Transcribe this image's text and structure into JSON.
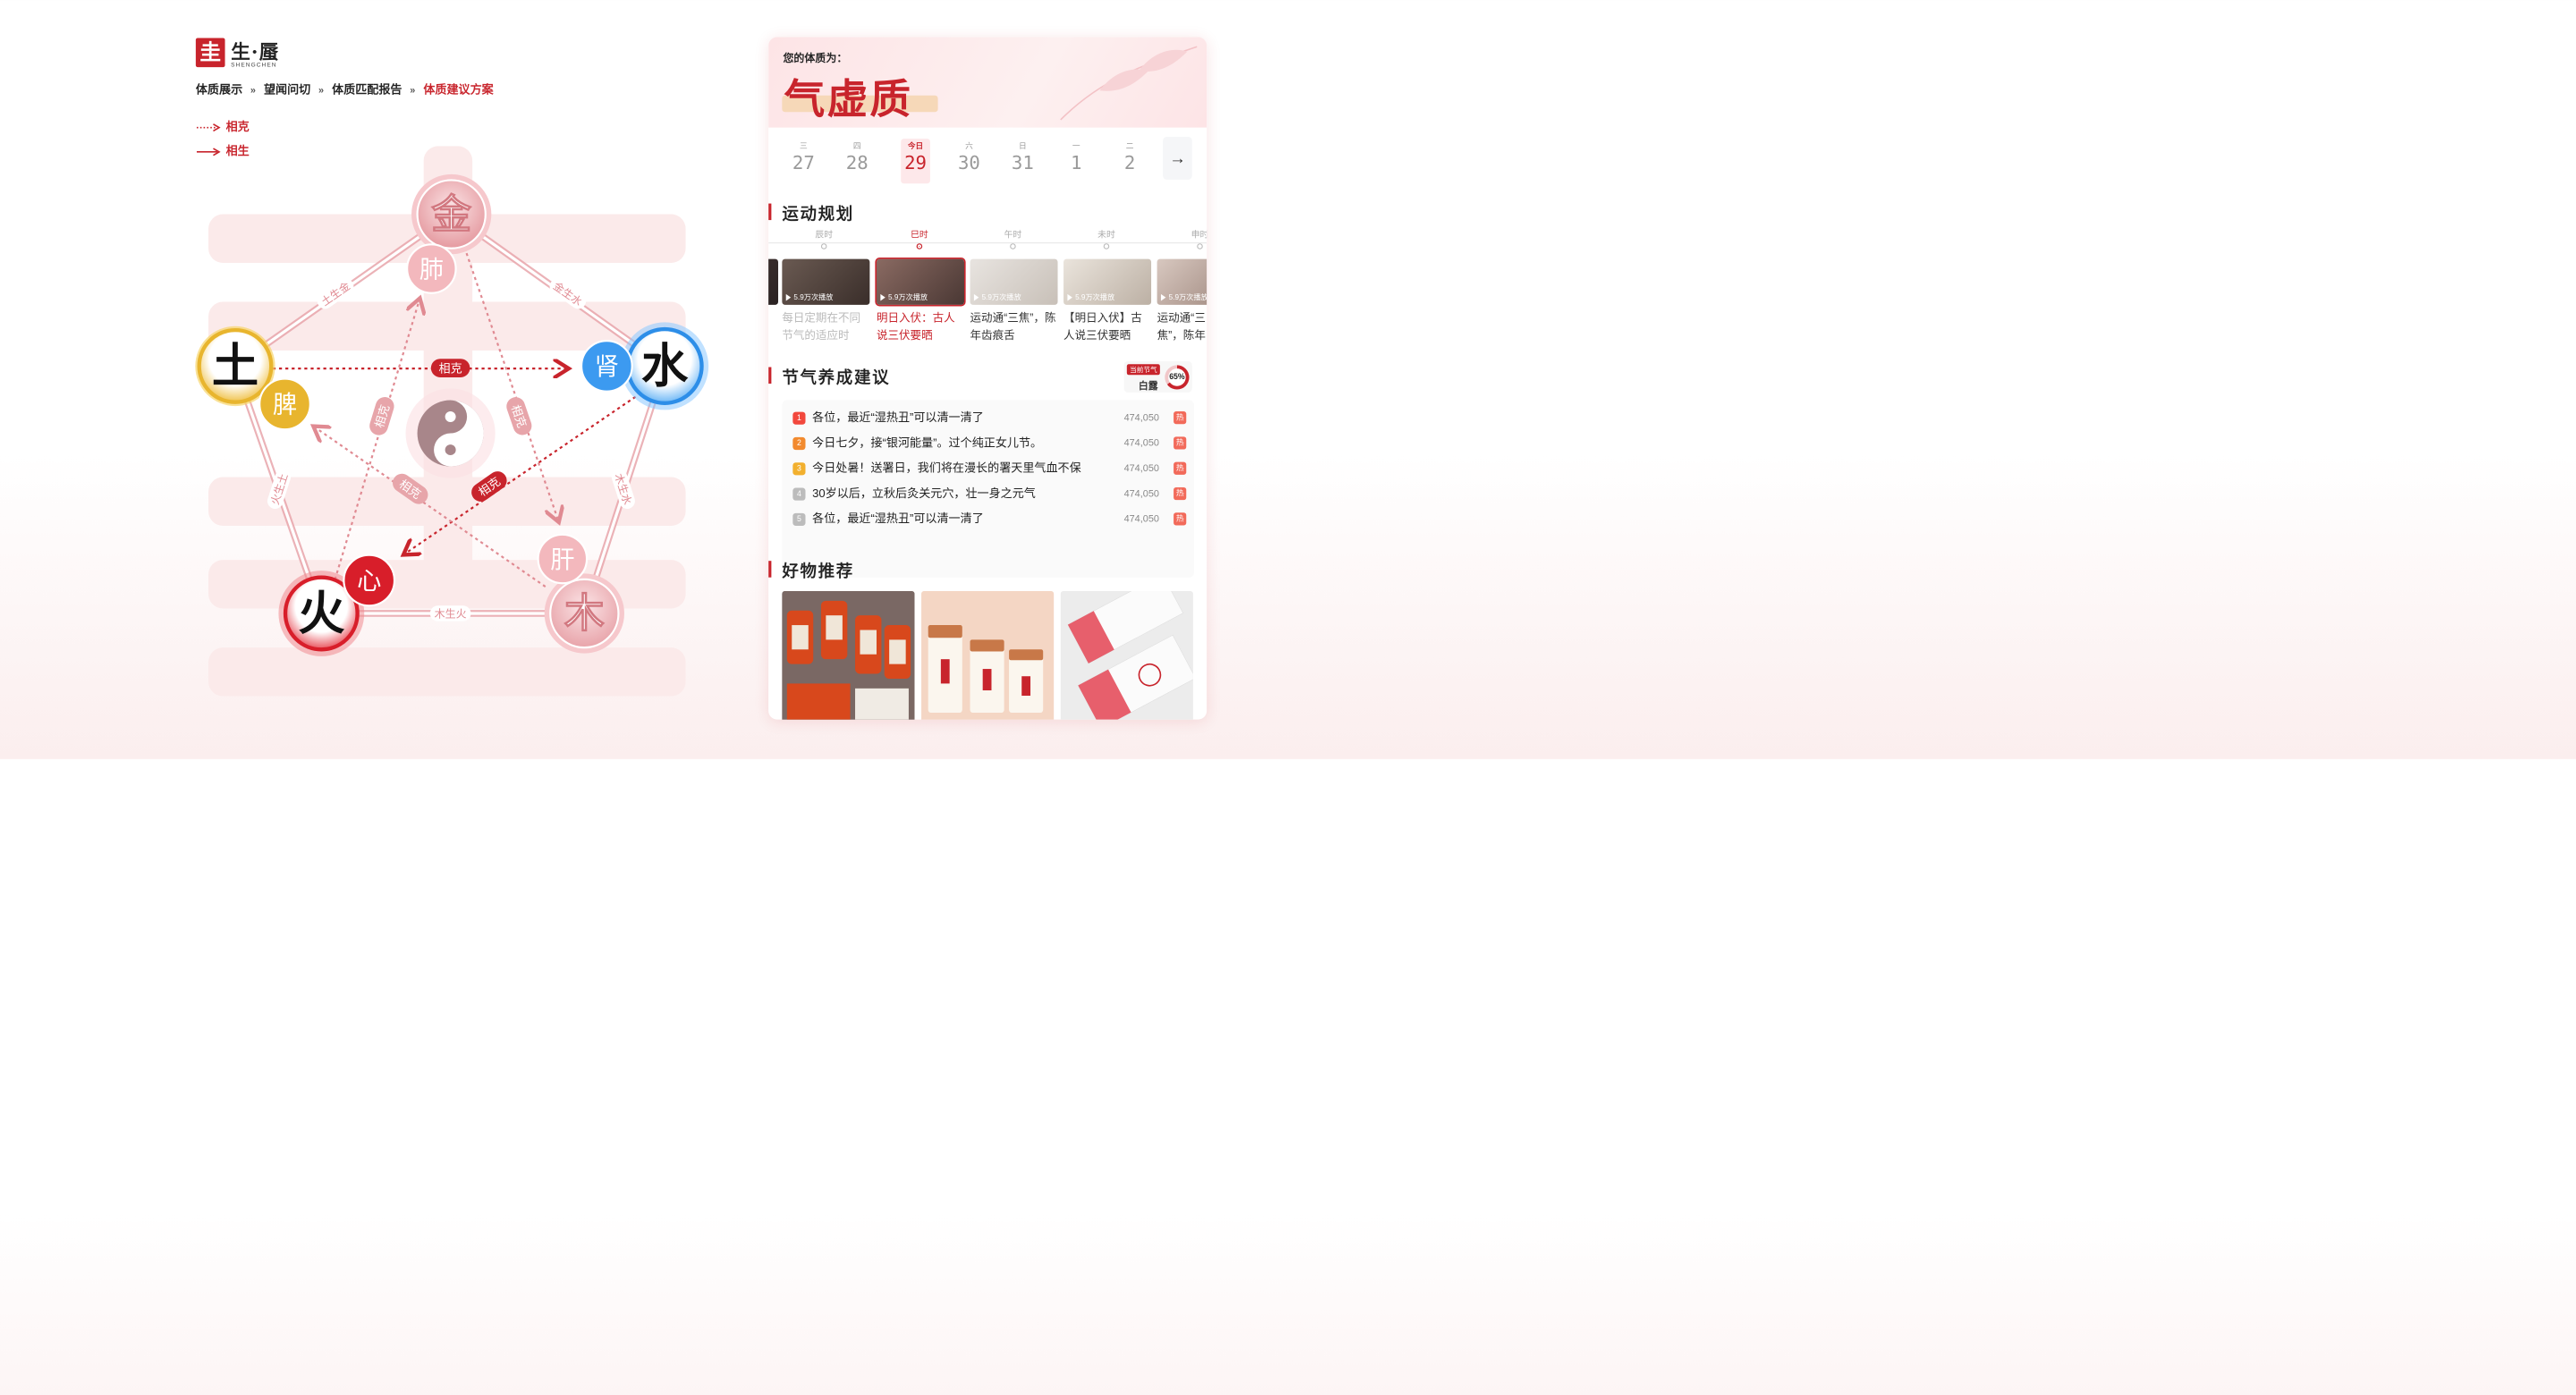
{
  "brand": {
    "logo_char": "圭",
    "title": "生·蜃",
    "subtitle": "SHENGCHEN"
  },
  "breadcrumb": [
    "体质展示",
    "望闻问切",
    "体质匹配报告",
    "体质建议方案"
  ],
  "breadcrumb_sep": "»",
  "legend": {
    "restrain": "相克",
    "generate": "相生"
  },
  "diagram": {
    "elements": {
      "metal": "金",
      "water": "水",
      "wood": "木",
      "fire": "火",
      "earth": "土"
    },
    "organs": {
      "lung": "肺",
      "kidney": "肾",
      "liver": "肝",
      "heart": "心",
      "spleen": "脾"
    },
    "generate_labels": {
      "earth_metal": "土生金",
      "metal_water": "金生水",
      "water_wood": "木生水",
      "wood_fire": "木生火",
      "fire_earth": "火生土"
    },
    "restrain_label": "相克"
  },
  "constitution": {
    "label": "您的体质为：",
    "name": "气虚质"
  },
  "calendar": {
    "days": [
      {
        "wk": "三",
        "d": "27"
      },
      {
        "wk": "四",
        "d": "28"
      },
      {
        "wk": "今日",
        "d": "29"
      },
      {
        "wk": "六",
        "d": "30"
      },
      {
        "wk": "日",
        "d": "31"
      },
      {
        "wk": "一",
        "d": "1"
      },
      {
        "wk": "二",
        "d": "2"
      }
    ],
    "more": "→"
  },
  "exercise": {
    "title": "运动规划",
    "times": [
      "辰时",
      "巳时",
      "午时",
      "未时",
      "申时"
    ],
    "videos": [
      {
        "plays": "5.9万次播放",
        "title": "每日定期在不同节气的适应时"
      },
      {
        "plays": "5.9万次播放",
        "title": "明日入伏：古人说三伏要晒"
      },
      {
        "plays": "5.9万次播放",
        "title": "运动通“三焦”，陈年齿痕舌"
      },
      {
        "plays": "5.9万次播放",
        "title": "【明日入伏】古人说三伏要晒"
      },
      {
        "plays": "5.9万次播放",
        "title": "运动通“三焦”，陈年齿痕舌"
      }
    ]
  },
  "solar_term": {
    "title": "节气养成建议",
    "current_tag": "当前节气",
    "current_term": "白露",
    "progress_label": "65%",
    "progress": 0.65,
    "items": [
      {
        "n": "1",
        "text": "各位，最近“湿热丑”可以清一清了",
        "count": "474,050",
        "hot": "热"
      },
      {
        "n": "2",
        "text": "今日七夕，接“银河能量”。过个纯正女儿节。",
        "count": "474,050",
        "hot": "热"
      },
      {
        "n": "3",
        "text": "今日处暑！送署日，我们将在漫长的署天里气血不保",
        "count": "474,050",
        "hot": "热"
      },
      {
        "n": "4",
        "text": "30岁以后，立秋后灸关元穴，壮一身之元气",
        "count": "474,050",
        "hot": "热"
      },
      {
        "n": "5",
        "text": "各位，最近“湿热丑”可以清一清了",
        "count": "474,050",
        "hot": "热"
      }
    ],
    "index_colors": [
      "#f2483d",
      "#f28a2e",
      "#f2b02e",
      "#bcbcbc",
      "#bcbcbc"
    ]
  },
  "goods": {
    "title": "好物推荐"
  },
  "colors": {
    "accent": "#c8242c",
    "metal": "#e8a0a6",
    "water": "#2d8ee8",
    "earth": "#e8b52e",
    "fire": "#d81e2a",
    "wood": "#e8a0a6"
  }
}
